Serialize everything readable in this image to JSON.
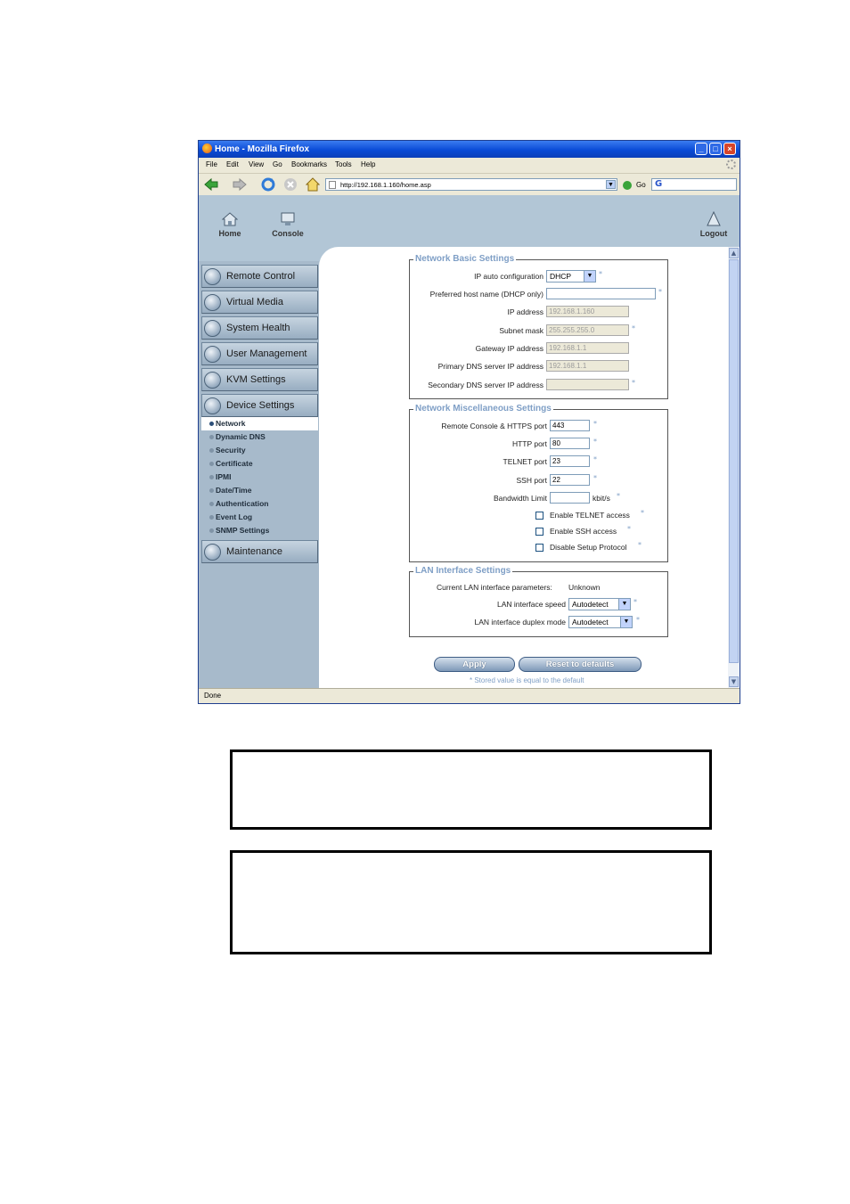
{
  "window": {
    "title": "Home - Mozilla Firefox",
    "controls": [
      "_",
      "□",
      "×"
    ]
  },
  "menu": [
    "File",
    "Edit",
    "View",
    "Go",
    "Bookmarks",
    "Tools",
    "Help"
  ],
  "toolbar": {
    "url": "http://192.168.1.160/home.asp",
    "go_label": "Go",
    "search_logo": "G"
  },
  "top_links": {
    "home": "Home",
    "console": "Console",
    "logout": "Logout"
  },
  "sidebar": {
    "categories": [
      "Remote Control",
      "Virtual Media",
      "System Health",
      "User Management",
      "KVM Settings",
      "Device Settings"
    ],
    "subitems": [
      "Network",
      "Dynamic DNS",
      "Security",
      "Certificate",
      "IPMI",
      "Date/Time",
      "Authentication",
      "Event Log",
      "SNMP Settings"
    ],
    "active_subitem": "Network",
    "maintenance": "Maintenance"
  },
  "basic": {
    "legend": "Network Basic Settings",
    "ip_auto_label": "IP auto configuration",
    "ip_auto_value": "DHCP",
    "hostname_label": "Preferred host name (DHCP only)",
    "hostname_value": "",
    "ip_label": "IP address",
    "ip_value": "192.168.1.160",
    "mask_label": "Subnet mask",
    "mask_value": "255.255.255.0",
    "gw_label": "Gateway IP address",
    "gw_value": "192.168.1.1",
    "dns1_label": "Primary DNS server IP address",
    "dns1_value": "192.168.1.1",
    "dns2_label": "Secondary DNS server IP address",
    "dns2_value": ""
  },
  "misc": {
    "legend": "Network Miscellaneous Settings",
    "https_label": "Remote Console & HTTPS port",
    "https_value": "443",
    "http_label": "HTTP port",
    "http_value": "80",
    "telnet_label": "TELNET port",
    "telnet_value": "23",
    "ssh_label": "SSH port",
    "ssh_value": "22",
    "bw_label": "Bandwidth Limit",
    "bw_value": "",
    "bw_unit": "kbit/s",
    "telnet_access": "Enable TELNET access",
    "ssh_access": "Enable SSH access",
    "setup_protocol": "Disable Setup Protocol"
  },
  "lan": {
    "legend": "LAN Interface Settings",
    "current_label": "Current LAN interface parameters:",
    "current_value": "Unknown",
    "speed_label": "LAN interface speed",
    "speed_value": "Autodetect",
    "duplex_label": "LAN interface duplex mode",
    "duplex_value": "Autodetect"
  },
  "asterisk": "*",
  "buttons": {
    "apply": "Apply",
    "reset": "Reset to defaults"
  },
  "footnote": "* Stored value is equal to the default",
  "status": "Done",
  "colors": {
    "title_bar": "#0a4bd6",
    "page_bg": "#b2c6d6",
    "legend": "#7f9fc6"
  }
}
